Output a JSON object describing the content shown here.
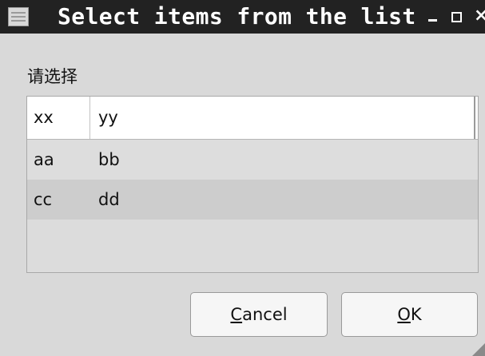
{
  "window": {
    "title": "Select items from the list",
    "minimize_glyph": "",
    "maximize_glyph": "",
    "close_glyph": "×"
  },
  "prompt": "请选择",
  "table": {
    "columns": [
      "xx",
      "yy"
    ],
    "rows": [
      [
        "aa",
        "bb"
      ],
      [
        "cc",
        "dd"
      ]
    ]
  },
  "buttons": {
    "cancel": {
      "mnemonic": "C",
      "rest": "ancel"
    },
    "ok": {
      "mnemonic": "O",
      "rest": "K"
    }
  },
  "icons": {
    "window_menu": "window-menu-icon",
    "resize": "resize-grip-icon"
  }
}
